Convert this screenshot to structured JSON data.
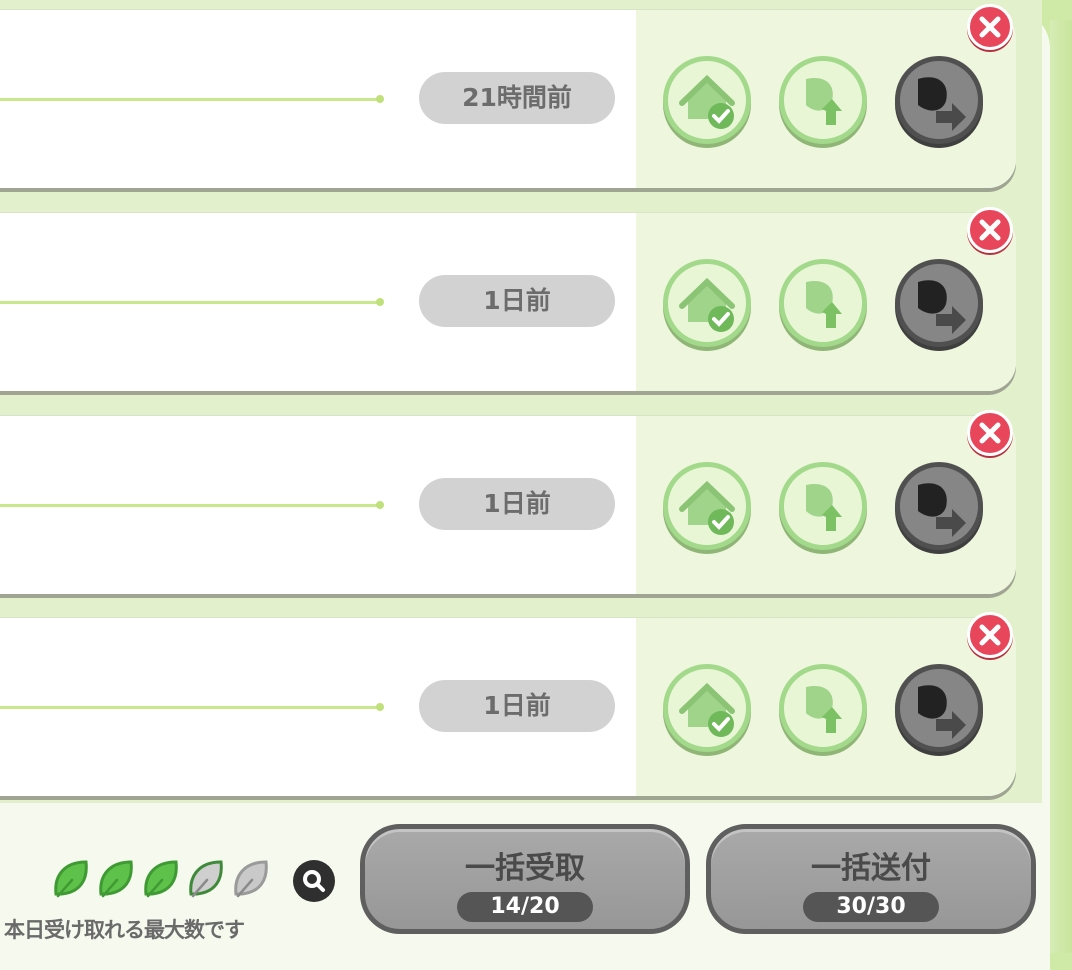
{
  "rows": [
    {
      "time": "21時間前"
    },
    {
      "time": "1日前"
    },
    {
      "time": "1日前"
    },
    {
      "time": "1日前"
    }
  ],
  "icons": {
    "house": "house-check-icon",
    "receive": "leaf-receive-icon",
    "send": "leaf-send-icon",
    "close": "close-icon",
    "search": "search-icon",
    "leaf": "leaf-icon"
  },
  "colors": {
    "accent_green": "#a3d98a",
    "close_red": "#e8465a",
    "disabled_gray": "#979797"
  },
  "footer": {
    "leaves_filled": 3,
    "leaves_total": 5,
    "daily_limit_note": "本日受け取れる最大数です",
    "bulk_receive_label": "一括受取",
    "bulk_receive_count": "14/20",
    "bulk_send_label": "一括送付",
    "bulk_send_count": "30/30"
  }
}
